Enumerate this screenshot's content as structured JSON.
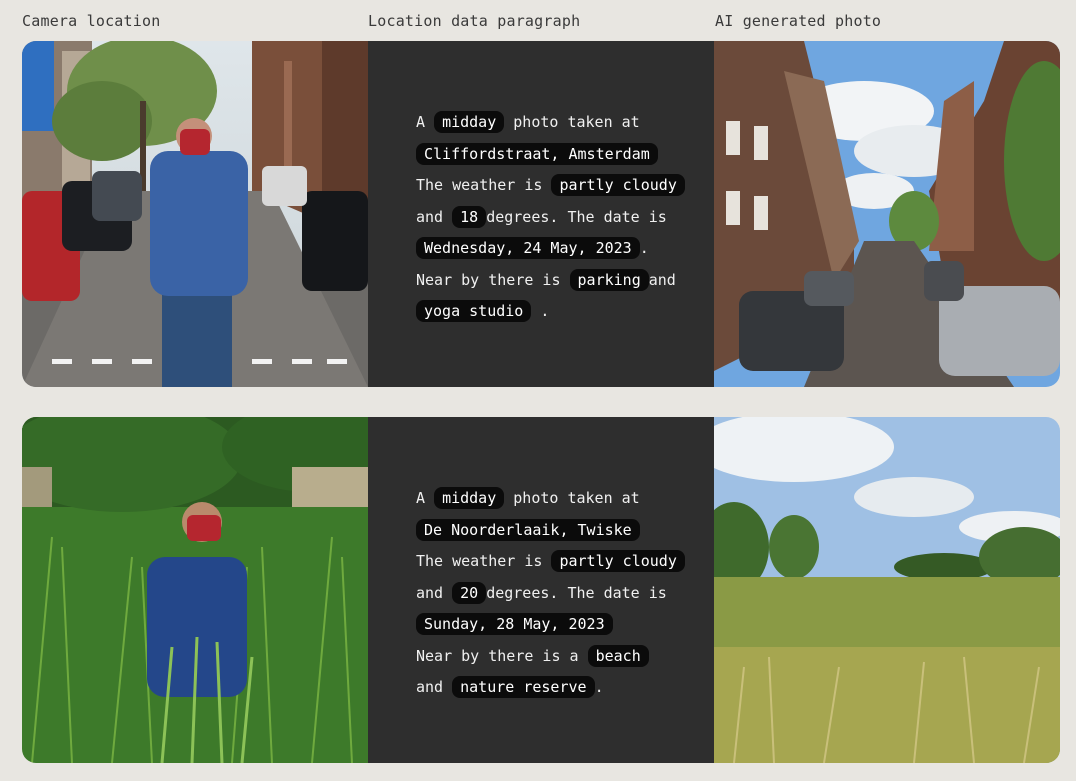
{
  "headers": {
    "camera": "Camera location",
    "paragraph": "Location data paragraph",
    "ai": "AI generated photo"
  },
  "rows": [
    {
      "time": "midday",
      "location": "Cliffordstraat, Amsterdam",
      "weather": "partly cloudy",
      "temperature": "18",
      "date": "Wednesday, 24 May, 2023",
      "near_prefix": "Near by there is",
      "near1": "parking",
      "near2": "yoga studio",
      "camera_image": "street-photo-person-with-mask",
      "ai_image": "ai-street-canal-houses"
    },
    {
      "time": "midday",
      "location": "De Noorderlaaik, Twiske",
      "weather": "partly cloudy",
      "temperature": "20",
      "date": "Sunday, 28 May, 2023",
      "near_prefix": "Near by there is a",
      "near1": "beach",
      "near2": "nature reserve",
      "camera_image": "grass-field-person-with-mask",
      "ai_image": "ai-grassland-trees"
    }
  ],
  "text": {
    "a": "A",
    "taken_at": "photo taken at",
    "weather_is": "The weather is",
    "and": "and",
    "degrees": "degrees. The date is",
    "period": "."
  }
}
